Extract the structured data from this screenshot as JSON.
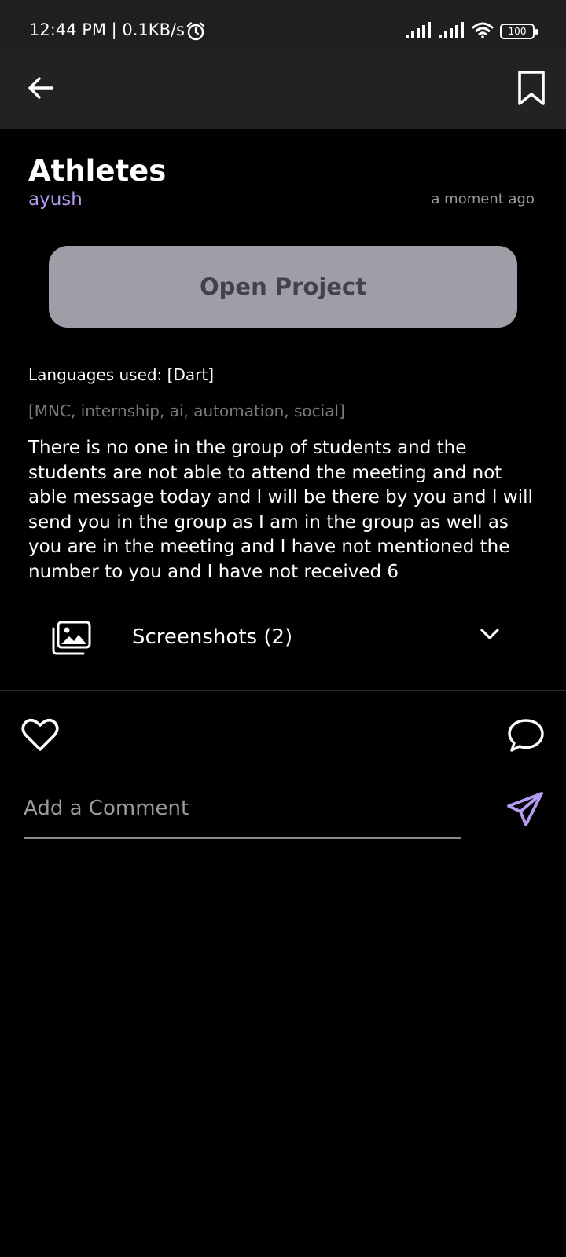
{
  "status_bar": {
    "time": "12:44 PM | 0.1KB/s",
    "battery": "100",
    "icons": [
      "alarm-icon",
      "signal-icon",
      "signal-icon",
      "wifi-icon",
      "battery-icon"
    ]
  },
  "app_bar": {
    "icons": [
      "arrow-left-icon",
      "bookmark-icon"
    ]
  },
  "project": {
    "title": "Athletes",
    "author": "ayush",
    "time_ago": "a moment ago",
    "open_label": "Open Project",
    "languages": "Languages used: [Dart]",
    "tags": "[MNC, internship, ai, automation, social]",
    "description": "There is no one in the group of students and the students are not able to attend the meeting and not able message today and I will be there by you and I will send you in the group as I am in the group as well as you are in the meeting and I have not mentioned the number to you and I have not received 6"
  },
  "screenshots": {
    "label": "Screenshots (2)",
    "icons": [
      "gallery-icon",
      "chevron-down-icon"
    ]
  },
  "actions": {
    "icons": [
      "heart-icon",
      "chat-bubble-icon"
    ]
  },
  "comment": {
    "placeholder": "Add a Comment",
    "value": "",
    "icons": [
      "send-icon"
    ]
  },
  "colors": {
    "background": "#000000",
    "bar": "#222222",
    "accent": "#b49cf0",
    "button_bg": "#9f9ea7",
    "button_text": "#43424a",
    "muted": "#7b7b7b"
  }
}
